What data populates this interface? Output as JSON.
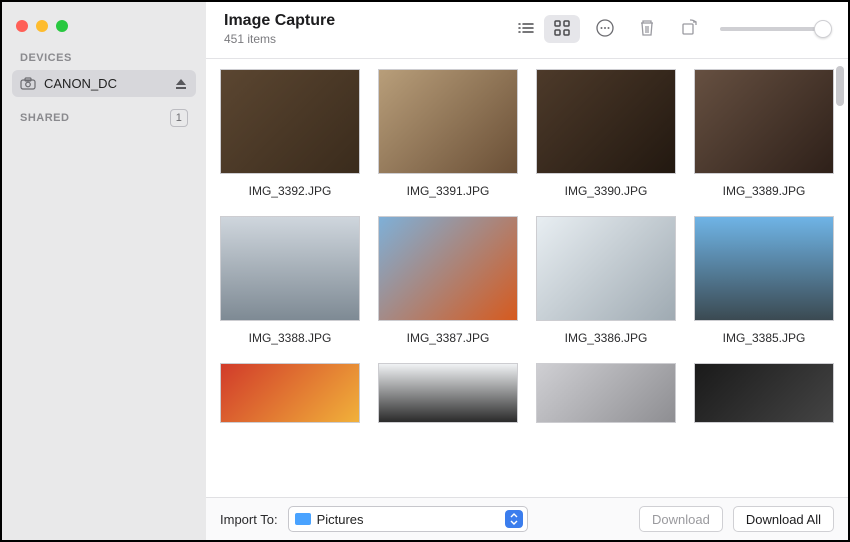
{
  "app": {
    "title": "Image Capture",
    "item_count_label": "451 items"
  },
  "sidebar": {
    "sections": {
      "devices_label": "DEVICES",
      "shared_label": "SHARED",
      "shared_badge": "1"
    },
    "device": {
      "name": "CANON_DC"
    }
  },
  "toolbar": {
    "icons": {
      "list": "list-icon",
      "grid": "grid-icon",
      "more": "more-icon",
      "trash": "trash-icon",
      "rotate": "rotate-icon"
    }
  },
  "grid": {
    "items": [
      {
        "filename": "IMG_3392.JPG"
      },
      {
        "filename": "IMG_3391.JPG"
      },
      {
        "filename": "IMG_3390.JPG"
      },
      {
        "filename": "IMG_3389.JPG"
      },
      {
        "filename": "IMG_3388.JPG"
      },
      {
        "filename": "IMG_3387.JPG"
      },
      {
        "filename": "IMG_3386.JPG"
      },
      {
        "filename": "IMG_3385.JPG"
      }
    ]
  },
  "footer": {
    "import_to_label": "Import To:",
    "destination": "Pictures",
    "download_label": "Download",
    "download_all_label": "Download All"
  }
}
